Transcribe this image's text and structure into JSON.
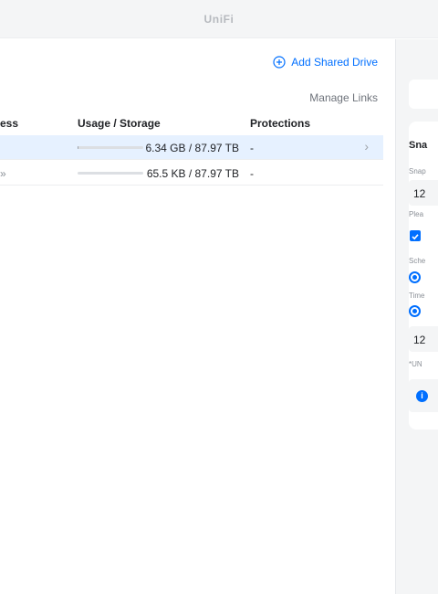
{
  "app": {
    "title": "UniFi"
  },
  "toolbar": {
    "add_drive_label": "Add Shared Drive",
    "manage_links_label": "Manage Links"
  },
  "table": {
    "columns": {
      "address": "ess",
      "usage": "Usage / Storage",
      "protections": "Protections"
    },
    "rows": [
      {
        "address": "",
        "usage": "6.34 GB / 87.97 TB",
        "usage_fraction": 0.0001,
        "protections": "-",
        "selected": true
      },
      {
        "address": "»",
        "usage": "65.5 KB / 87.97 TB",
        "usage_fraction": 0.0,
        "protections": "-",
        "selected": false
      }
    ]
  },
  "panel": {
    "title": "Sna",
    "snapshot_label": "Snap",
    "snapshot_value": "12",
    "hint": "Plea",
    "schedule_label": "Sche",
    "time_label": "Time",
    "time_value": "12",
    "note": "*UN",
    "info_icon_text": "i"
  },
  "colors": {
    "accent": "#006fff",
    "selected_row": "#e6f1ff",
    "panel_bg": "#f4f5f6"
  }
}
